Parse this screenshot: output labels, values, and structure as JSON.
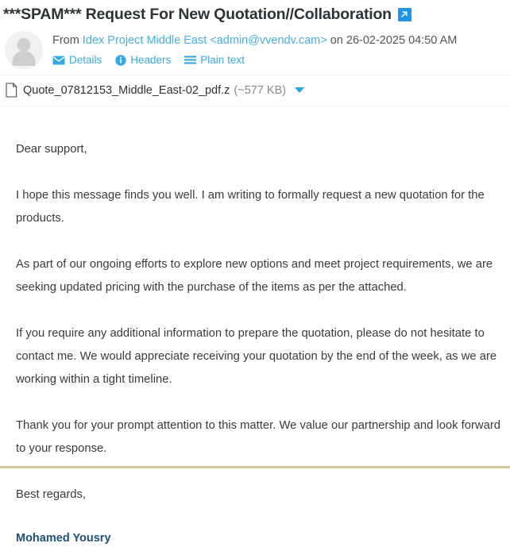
{
  "message": {
    "subject": "***SPAM*** Request For New Quotation//Collaboration",
    "open_in_new_window_icon": "external-link-icon",
    "accent_color": "#2196e8",
    "link_color": "#37a9e0",
    "signature_color": "#1f4e79"
  },
  "sender": {
    "avatar_icon": "person-avatar-icon",
    "from_label": "From",
    "display_name_and_address": "Idex Project Middle East <admin@vvendv.cam>",
    "date_text": " on 26-02-2025 04:50 AM"
  },
  "actions": [
    {
      "label": "Details",
      "icon": "envelope-icon"
    },
    {
      "label": "Headers",
      "icon": "info-circle-icon"
    },
    {
      "label": "Plain text",
      "icon": "list-lines-icon"
    }
  ],
  "attachment": {
    "file_icon": "document-file-icon",
    "filename": "Quote_07812153_Middle_East-02_pdf.z",
    "size": "(~577 KB)",
    "menu_icon": "caret-down-icon"
  },
  "body": {
    "greeting": "Dear support,",
    "paragraphs": [
      " I hope this message finds you well. I am writing to formally request a new quotation for the products.",
      "As part of our ongoing efforts to explore new options and meet project requirements, we are seeking updated pricing with the purchase of the items as per the attached.",
      "If you require any additional information to prepare the quotation, please do not hesitate to contact me. We would appreciate receiving your quotation by the end of the week, as we are working within a tight timeline.",
      "Thank you for your prompt attention to this matter. We value our partnership and look forward to your response."
    ],
    "closing": "Best regards,",
    "signature": "Mohamed Yousry"
  }
}
